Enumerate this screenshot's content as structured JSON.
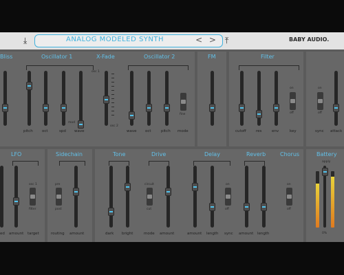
{
  "header": {
    "preset_name": "ANALOG MODELED SYNTH",
    "prev_next": "< >",
    "brand": "BABY AUDIO.",
    "download_icon": "download-icon",
    "upload_icon": "upload-icon"
  },
  "sections": {
    "bliss": {
      "title": "Bliss"
    },
    "osc1": {
      "title": "Oscillator 1",
      "labels": [
        "pitch",
        "oct",
        "spd",
        "wave"
      ],
      "mod_label": "mod"
    },
    "xfade": {
      "title": "X-Fade",
      "top_label": "osc 1",
      "bottom_label": "osc 2"
    },
    "osc2": {
      "title": "Oscillator 2",
      "labels": [
        "wave",
        "oct",
        "pitch",
        "mode"
      ],
      "switch_label": "fine"
    },
    "fm": {
      "title": "FM"
    },
    "filter": {
      "title": "Filter",
      "labels": [
        "cutoff",
        "res",
        "env",
        "key"
      ],
      "switch_on": "on",
      "switch_off": "off"
    },
    "amp": {
      "switch_on": "on",
      "switch_off": "off",
      "labels": [
        "sync",
        "attack"
      ]
    },
    "lfo": {
      "title": "LFO",
      "labels": [
        "amount",
        "target"
      ],
      "left_label": "ed",
      "switch_top": "osc 1",
      "switch_bottom": "filter"
    },
    "sidechain": {
      "title": "Sidechain",
      "switch_top": "pre",
      "switch_bottom": "post",
      "labels": [
        "routing",
        "amount"
      ]
    },
    "tone": {
      "title": "Tone",
      "labels": [
        "dark",
        "bright"
      ]
    },
    "drive": {
      "title": "Drive",
      "switch_top": "circuit",
      "switch_bottom": "cut",
      "labels": [
        "mode",
        "amount"
      ]
    },
    "delay": {
      "title": "Delay",
      "labels": [
        "amount",
        "length",
        "sync"
      ],
      "switch_on": "on",
      "switch_off": "off"
    },
    "reverb": {
      "title": "Reverb",
      "labels": [
        "amount",
        "length"
      ]
    },
    "chorus": {
      "title": "Chorus",
      "switch_on": "on",
      "switch_off": "off"
    },
    "battery": {
      "title": "Battery",
      "top_label": "apply",
      "bottom_label": "0%",
      "meter_left": 0.78,
      "meter_right": 0.9
    }
  },
  "colors": {
    "accent": "#4fc3ee",
    "title": "#62c0e8",
    "panel": "#676767",
    "meter_orange": "#e07a1f",
    "meter_yellow": "#e9d33a"
  }
}
